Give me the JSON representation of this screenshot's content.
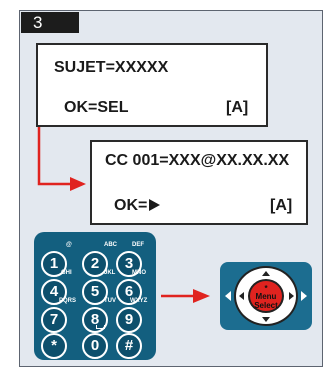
{
  "step": {
    "number": "3"
  },
  "display1": {
    "line1": "SUJET=XXXXX",
    "line2": "OK=SEL",
    "tag": "[A]"
  },
  "display2": {
    "line1": "CC 001=XXX@XX.XX.XX",
    "line2": "OK=",
    "tag": "[A]"
  },
  "keypad": {
    "keys": [
      {
        "digit": "1",
        "letters": "@"
      },
      {
        "digit": "2",
        "letters": "ABC"
      },
      {
        "digit": "3",
        "letters": "DEF"
      },
      {
        "digit": "4",
        "letters": "GHI"
      },
      {
        "digit": "5",
        "letters": "JKL"
      },
      {
        "digit": "6",
        "letters": "MNO"
      },
      {
        "digit": "7",
        "letters": "PQRS"
      },
      {
        "digit": "8",
        "letters": "TUV"
      },
      {
        "digit": "9",
        "letters": "WXYZ"
      },
      {
        "digit": "*",
        "letters": ""
      },
      {
        "digit": "0",
        "letters": ""
      },
      {
        "digit": "#",
        "letters": ""
      }
    ]
  },
  "nav": {
    "star": "*",
    "line1": "Menu",
    "line2": "Select"
  },
  "colors": {
    "arrow": "#e0231f",
    "keypad": "#135f7f",
    "panel": "#e3e8ef"
  }
}
